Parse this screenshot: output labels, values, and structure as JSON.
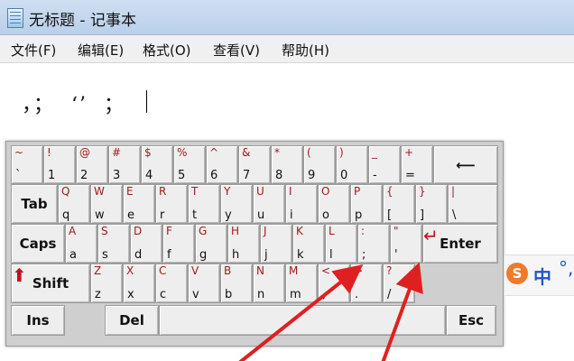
{
  "window": {
    "title": "无标题 - 记事本",
    "icon": "notepad-icon"
  },
  "menu": [
    "文件(F)",
    "编辑(E)",
    "格式(O)",
    "查看(V)",
    "帮助(H)"
  ],
  "editor": {
    "text": "，；  ‘’  ；"
  },
  "keyboard": {
    "keys": [
      {
        "name": "key-backtick",
        "s": "~",
        "b": "`"
      },
      {
        "name": "key-1",
        "s": "!",
        "b": "1"
      },
      {
        "name": "key-2",
        "s": "@",
        "b": "2"
      },
      {
        "name": "key-3",
        "s": "#",
        "b": "3"
      },
      {
        "name": "key-4",
        "s": "$",
        "b": "4"
      },
      {
        "name": "key-5",
        "s": "%",
        "b": "5"
      },
      {
        "name": "key-6",
        "s": "^",
        "b": "6"
      },
      {
        "name": "key-7",
        "s": "&",
        "b": "7"
      },
      {
        "name": "key-8",
        "s": "*",
        "b": "8"
      },
      {
        "name": "key-9",
        "s": "(",
        "b": "9"
      },
      {
        "name": "key-0",
        "s": ")",
        "b": "0"
      },
      {
        "name": "key-minus",
        "s": "_",
        "b": "-"
      },
      {
        "name": "key-equals",
        "s": "+",
        "b": "="
      },
      {
        "name": "key-backspace",
        "label": "⟵",
        "icon": "backspace-arrow-icon"
      },
      {
        "name": "key-tab",
        "label": "Tab"
      },
      {
        "name": "key-q",
        "s": "Q",
        "b": "q"
      },
      {
        "name": "key-w",
        "s": "W",
        "b": "w"
      },
      {
        "name": "key-e",
        "s": "E",
        "b": "e"
      },
      {
        "name": "key-r",
        "s": "R",
        "b": "r"
      },
      {
        "name": "key-t",
        "s": "T",
        "b": "t"
      },
      {
        "name": "key-y",
        "s": "Y",
        "b": "y"
      },
      {
        "name": "key-u",
        "s": "U",
        "b": "u"
      },
      {
        "name": "key-i",
        "s": "I",
        "b": "i"
      },
      {
        "name": "key-o",
        "s": "O",
        "b": "o"
      },
      {
        "name": "key-p",
        "s": "P",
        "b": "p"
      },
      {
        "name": "key-lbracket",
        "s": "{",
        "b": "["
      },
      {
        "name": "key-rbracket",
        "s": "}",
        "b": "]"
      },
      {
        "name": "key-backslash",
        "s": "|",
        "b": "\\"
      },
      {
        "name": "key-caps",
        "label": "Caps"
      },
      {
        "name": "key-a",
        "s": "A",
        "b": "a"
      },
      {
        "name": "key-s",
        "s": "S",
        "b": "s"
      },
      {
        "name": "key-d",
        "s": "D",
        "b": "d"
      },
      {
        "name": "key-f",
        "s": "F",
        "b": "f"
      },
      {
        "name": "key-g",
        "s": "G",
        "b": "g"
      },
      {
        "name": "key-h",
        "s": "H",
        "b": "h"
      },
      {
        "name": "key-j",
        "s": "J",
        "b": "j"
      },
      {
        "name": "key-k",
        "s": "K",
        "b": "k"
      },
      {
        "name": "key-l",
        "s": "L",
        "b": "l"
      },
      {
        "name": "key-semicolon",
        "s": ":",
        "b": ";"
      },
      {
        "name": "key-quote",
        "s": "\"",
        "b": "'"
      },
      {
        "name": "key-enter",
        "label": "Enter",
        "icon": "enter-arrow-icon"
      },
      {
        "name": "key-shift",
        "label": "Shift",
        "icon": "shift-arrow-icon"
      },
      {
        "name": "key-z",
        "s": "Z",
        "b": "z"
      },
      {
        "name": "key-x",
        "s": "X",
        "b": "x"
      },
      {
        "name": "key-c",
        "s": "C",
        "b": "c"
      },
      {
        "name": "key-v",
        "s": "V",
        "b": "v"
      },
      {
        "name": "key-b",
        "s": "B",
        "b": "b"
      },
      {
        "name": "key-n",
        "s": "N",
        "b": "n"
      },
      {
        "name": "key-m",
        "s": "M",
        "b": "m"
      },
      {
        "name": "key-comma",
        "s": "<",
        "b": ","
      },
      {
        "name": "key-period",
        "s": ">",
        "b": "."
      },
      {
        "name": "key-slash",
        "s": "?",
        "b": "/"
      },
      {
        "name": "key-ins",
        "label": "Ins"
      },
      {
        "name": "key-del",
        "label": "Del"
      },
      {
        "name": "key-space",
        "label": ""
      },
      {
        "name": "key-esc",
        "label": "Esc"
      }
    ]
  },
  "ime": {
    "logo": "S",
    "mode": "中",
    "punct": "°,"
  },
  "colors": {
    "shift_label": "#a11c1c",
    "annotation_arrow": "#e02020",
    "arrow_icon": "#c0121e"
  }
}
